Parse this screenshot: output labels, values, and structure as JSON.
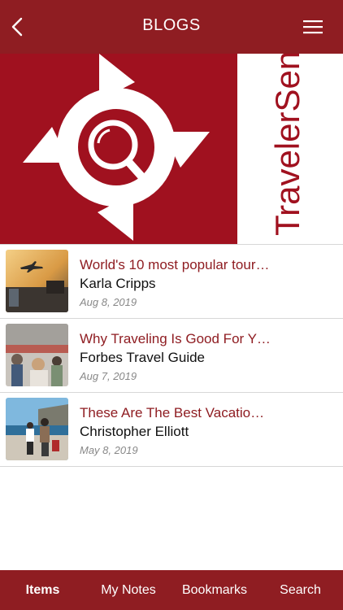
{
  "header": {
    "title": "BLOGS",
    "back_icon": "chevron-left-icon",
    "menu_icon": "hamburger-menu-icon"
  },
  "banner": {
    "logo_icon": "compass-magnifier-logo",
    "brand_text": "TravelerSense",
    "brand_color": "#a0111f"
  },
  "posts": [
    {
      "title": "World's 10 most popular tour…",
      "author": "Karla Cripps",
      "date": "Aug 8, 2019"
    },
    {
      "title": "Why Traveling Is Good For Y…",
      "author": "Forbes Travel Guide",
      "date": "Aug 7, 2019"
    },
    {
      "title": "These Are The Best Vacatio…",
      "author": "Christopher Elliott",
      "date": "May 8, 2019"
    }
  ],
  "tabs": [
    {
      "label": "Items",
      "active": true
    },
    {
      "label": "My Notes",
      "active": false
    },
    {
      "label": "Bookmarks",
      "active": false
    },
    {
      "label": "Search",
      "active": false
    }
  ],
  "colors": {
    "header_bg": "#8f1d22",
    "title_text": "#8f1d22",
    "date_text": "#888888"
  }
}
